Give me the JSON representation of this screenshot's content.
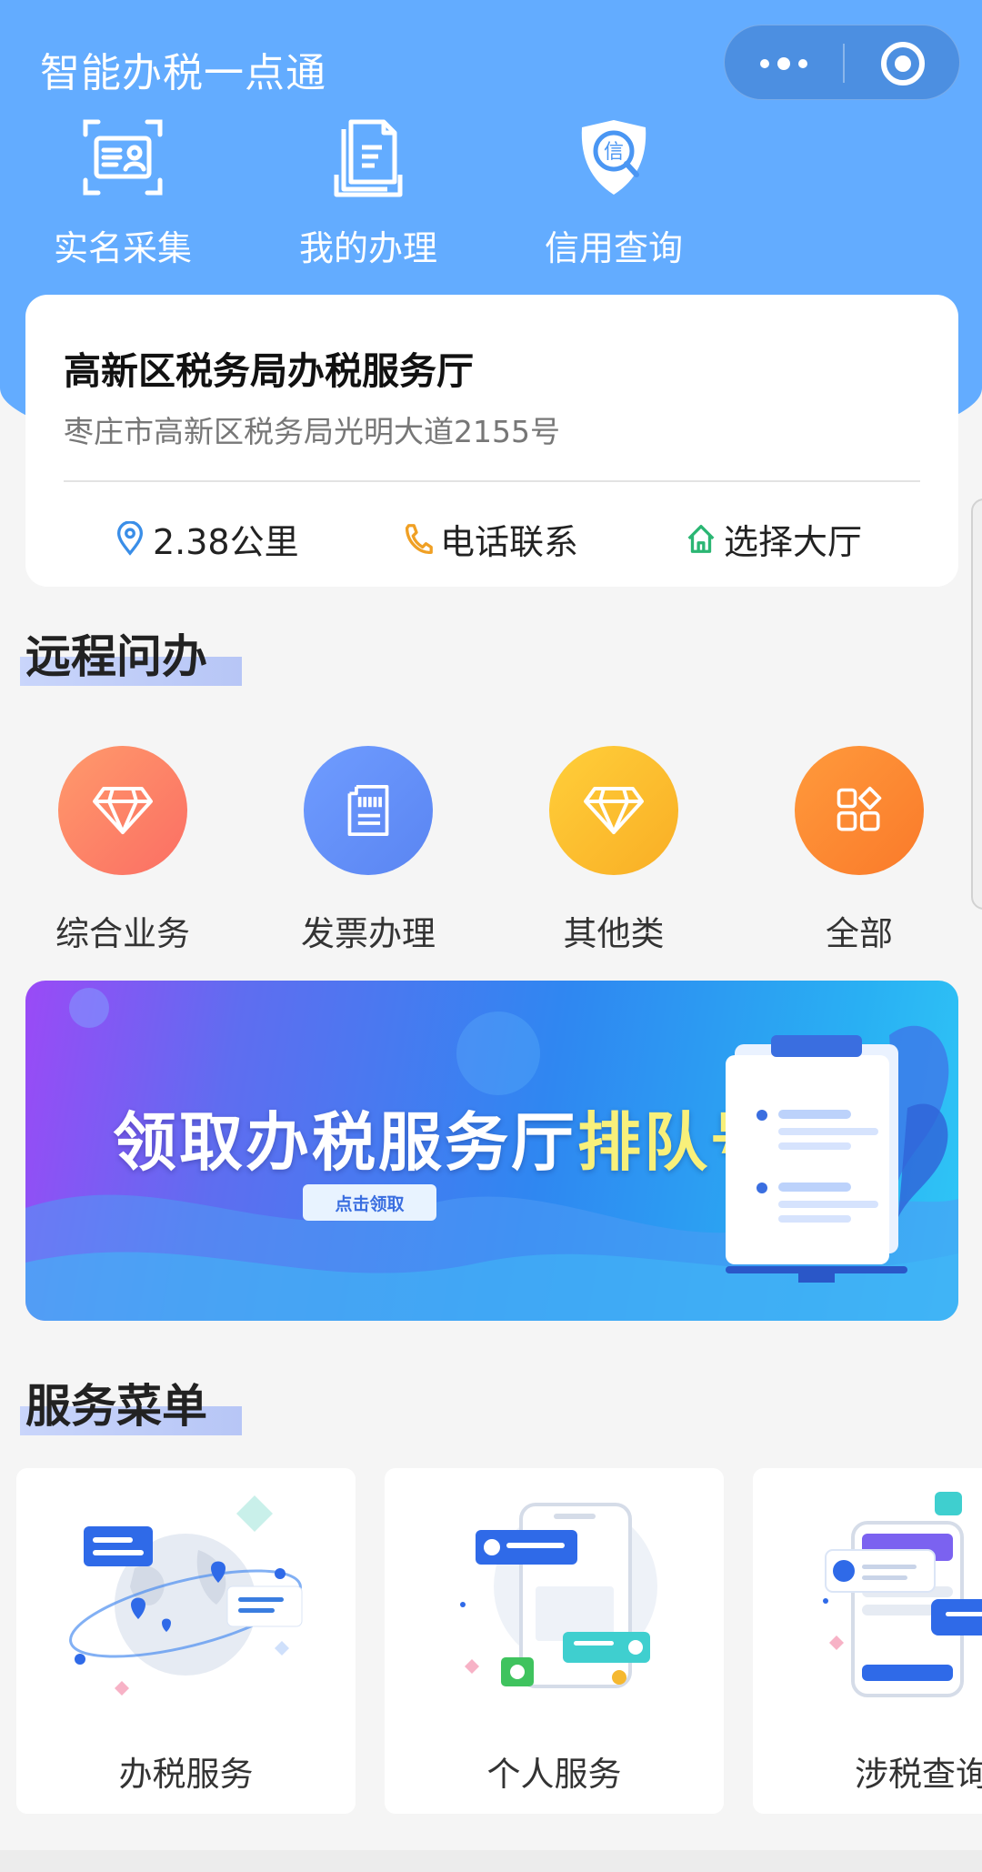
{
  "app": {
    "title": "智能办税一点通"
  },
  "capsule": {
    "more_icon": "more-dots-icon",
    "close_icon": "target-close-icon"
  },
  "quick_actions": [
    {
      "label": "实名采集",
      "icon": "id-card-scan-icon"
    },
    {
      "label": "我的办理",
      "icon": "document-stack-icon"
    },
    {
      "label": "信用查询",
      "icon": "credit-shield-icon"
    }
  ],
  "hall": {
    "name": "高新区税务局办税服务厅",
    "address": "枣庄市高新区税务局光明大道2155号",
    "distance": "2.38公里",
    "phone_label": "电话联系",
    "select_label": "选择大厅"
  },
  "remote": {
    "title": "远程问办",
    "items": [
      {
        "label": "综合业务",
        "icon": "diamond-icon",
        "colors": [
          "#ff9a6b",
          "#fb6e64"
        ]
      },
      {
        "label": "发票办理",
        "icon": "invoice-icon",
        "colors": [
          "#6f9cff",
          "#5a85f2"
        ]
      },
      {
        "label": "其他类",
        "icon": "diamond-icon",
        "colors": [
          "#ffcf3a",
          "#f9ae25"
        ]
      },
      {
        "label": "全部",
        "icon": "grid-apps-icon",
        "colors": [
          "#ff9a3c",
          "#fa7a2a"
        ]
      }
    ]
  },
  "banner": {
    "text_main": "领取办税服务厅",
    "text_highlight": "排队号",
    "button": "点击领取"
  },
  "menu": {
    "title": "服务菜单",
    "items": [
      {
        "label": "办税服务",
        "icon": "globe-map-illustration"
      },
      {
        "label": "个人服务",
        "icon": "phone-chat-illustration"
      },
      {
        "label": "涉税查询",
        "icon": "phone-search-illustration"
      }
    ]
  },
  "colors": {
    "header": "#63acff",
    "accent": "#3a7de0"
  }
}
